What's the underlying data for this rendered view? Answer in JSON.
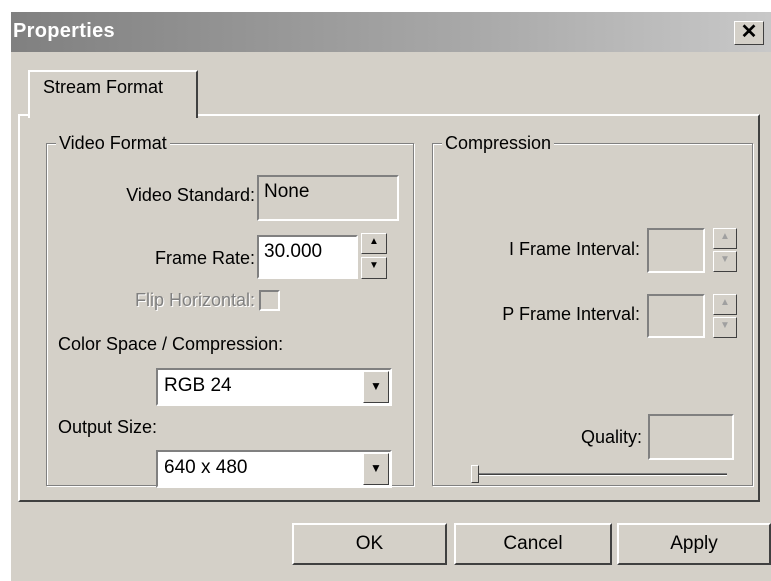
{
  "window": {
    "title": "Properties",
    "close_glyph": "✕"
  },
  "tabs": [
    {
      "label": "Stream Format",
      "selected": true
    }
  ],
  "video_format": {
    "group_title": "Video Format",
    "video_standard_label": "Video Standard:",
    "video_standard_value": "None",
    "frame_rate_label": "Frame Rate:",
    "frame_rate_value": "30.000",
    "flip_horizontal_label": "Flip Horizontal:",
    "flip_horizontal_checked": false,
    "color_space_label": "Color Space / Compression:",
    "color_space_value": "RGB 24",
    "output_size_label": "Output Size:",
    "output_size_value": "640 x 480"
  },
  "compression": {
    "group_title": "Compression",
    "i_frame_label": "I Frame Interval:",
    "i_frame_value": "",
    "p_frame_label": "P Frame Interval:",
    "p_frame_value": "",
    "quality_label": "Quality:",
    "quality_value": "",
    "quality_slider_fraction": 0.0
  },
  "buttons": {
    "ok": "OK",
    "cancel": "Cancel",
    "apply": "Apply"
  },
  "glyphs": {
    "up": "▲",
    "down": "▼"
  },
  "icons": [
    "close-icon",
    "spin-up-icon",
    "spin-down-icon",
    "dropdown-arrow-icon"
  ]
}
